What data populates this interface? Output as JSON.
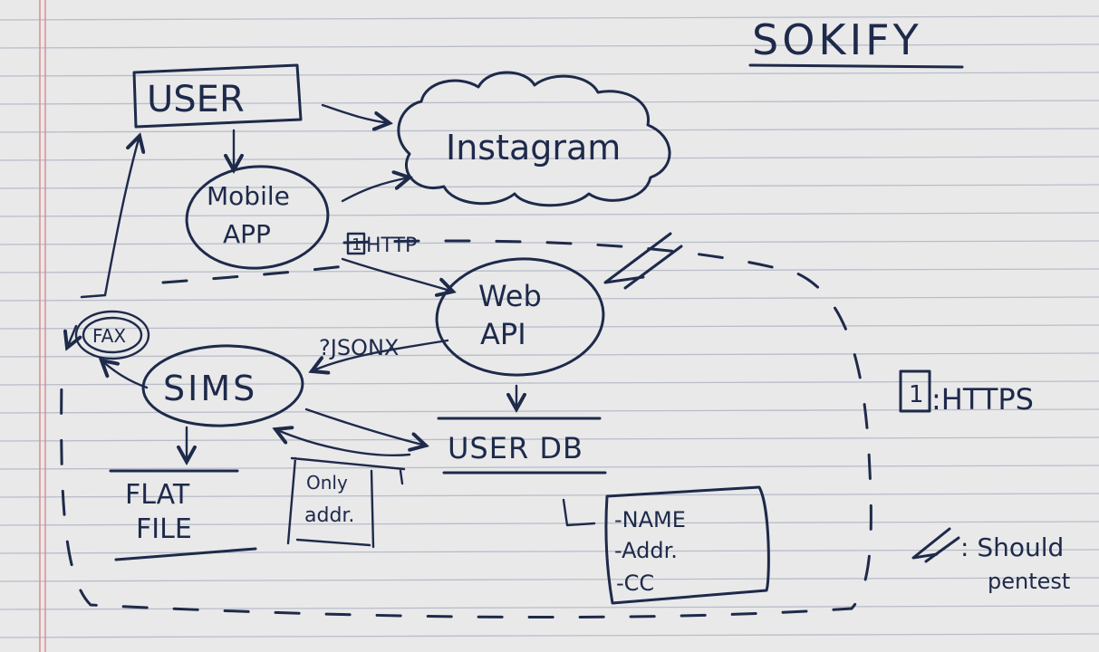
{
  "title": "SOKIFY",
  "nodes": {
    "user": "USER",
    "instagram": "Instagram",
    "mobile_app": [
      "Mobile",
      "APP"
    ],
    "web_api": [
      "Web",
      "API"
    ],
    "sims": "SIMS",
    "fax": "FAX",
    "user_db": "USER DB",
    "flat_file": [
      "FLAT",
      "FILE"
    ],
    "only_addr": [
      "Only",
      "addr."
    ]
  },
  "edge_labels": {
    "http": "HTTP",
    "http_marker": "1",
    "jsonx": "?JSONX"
  },
  "user_db_fields": [
    "-NAME",
    "-Addr.",
    "-CC"
  ],
  "legend": {
    "https_marker": "1",
    "https_text": ":HTTPS",
    "pentest_text": [
      ": Should",
      "pentest"
    ]
  },
  "colors": {
    "paper": "#e9e9ea",
    "ink": "#1e2a4a",
    "rule": "#b9bdc9",
    "margin": "#d98a8a"
  }
}
